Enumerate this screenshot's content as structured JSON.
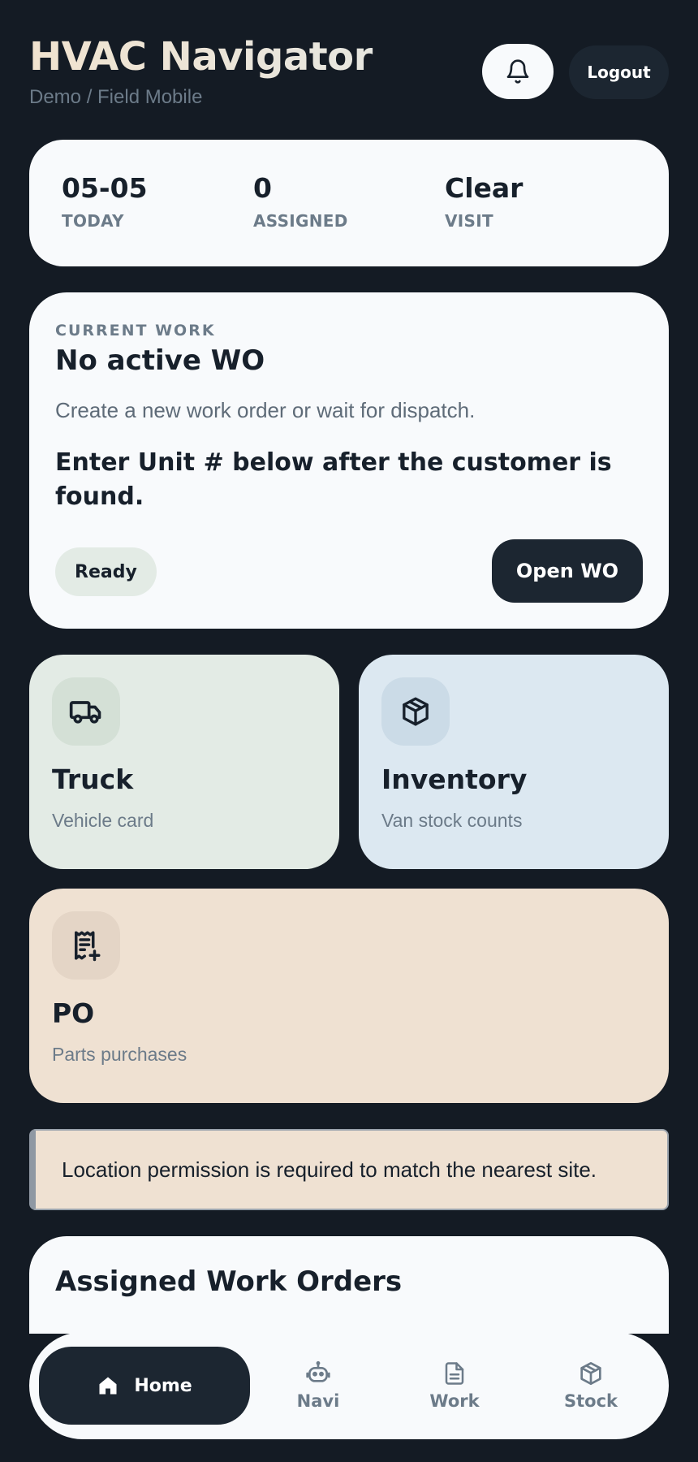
{
  "header": {
    "title": "HVAC Navigator",
    "subtitle": "Demo / Field Mobile",
    "bell_icon": "bell-icon",
    "logout_label": "Logout"
  },
  "stats": [
    {
      "value": "05-05",
      "label": "TODAY"
    },
    {
      "value": "0",
      "label": "ASSIGNED"
    },
    {
      "value": "Clear",
      "label": "VISIT"
    }
  ],
  "current_work": {
    "kicker": "CURRENT WORK",
    "title": "No active WO",
    "description": "Create a new work order or wait for dispatch.",
    "note": "Enter Unit # below after the customer is found.",
    "status": "Ready",
    "open_label": "Open WO"
  },
  "tiles": {
    "truck": {
      "icon": "truck-icon",
      "title": "Truck",
      "subtitle": "Vehicle card"
    },
    "inventory": {
      "icon": "box-icon",
      "title": "Inventory",
      "subtitle": "Van stock counts"
    },
    "po": {
      "icon": "receipt-plus-icon",
      "title": "PO",
      "subtitle": "Parts purchases"
    }
  },
  "location_banner": "Location permission is required to match the nearest site.",
  "assigned": {
    "title": "Assigned Work Orders"
  },
  "nav": {
    "home": "Home",
    "navi": "Navi",
    "work": "Work",
    "stock": "Stock"
  },
  "colors": {
    "background": "#141b24",
    "card": "#f8fafc",
    "dark_button": "#1c2631",
    "truck_tile": "#e3ebe5",
    "inventory_tile": "#dce8f1",
    "po_tile": "#efe1d2",
    "muted_text": "#6c7b89"
  }
}
